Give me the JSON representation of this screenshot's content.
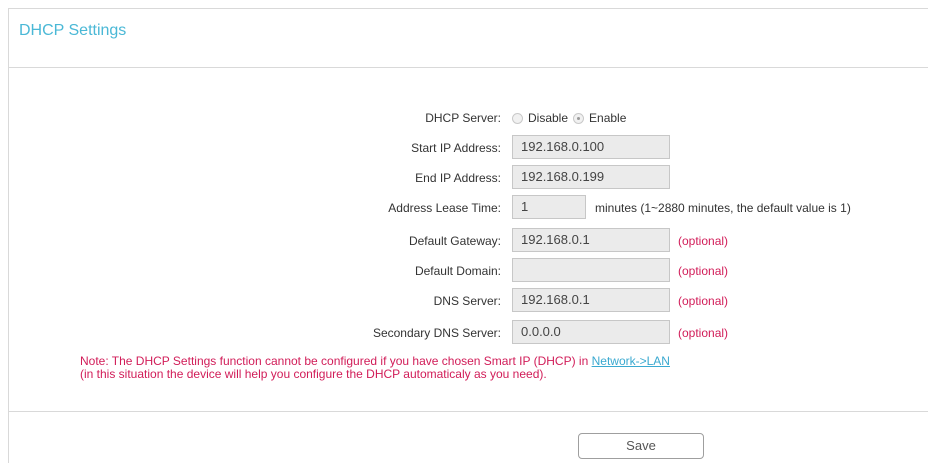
{
  "panel": {
    "title": "DHCP Settings"
  },
  "form": {
    "dhcp_server": {
      "label": "DHCP Server:",
      "options": [
        "Disable",
        "Enable"
      ],
      "selected": "Enable"
    },
    "start_ip": {
      "label": "Start IP Address:",
      "value": "192.168.0.100"
    },
    "end_ip": {
      "label": "End IP Address:",
      "value": "192.168.0.199"
    },
    "lease_time": {
      "label": "Address Lease Time:",
      "value": "1",
      "hint": "minutes (1~2880 minutes, the default value is 1)"
    },
    "default_gateway": {
      "label": "Default Gateway:",
      "value": "192.168.0.1",
      "note": "(optional)"
    },
    "default_domain": {
      "label": "Default Domain:",
      "value": "",
      "note": "(optional)"
    },
    "dns_server": {
      "label": "DNS Server:",
      "value": "192.168.0.1",
      "note": "(optional)"
    },
    "secondary_dns": {
      "label": "Secondary DNS Server:",
      "value": "0.0.0.0",
      "note": "(optional)"
    }
  },
  "note": {
    "line1": "Note: The DHCP Settings function cannot be configured if you have chosen Smart IP (DHCP) in ",
    "link": "Network->LAN",
    "line2": "(in this situation the device will help you configure the DHCP automaticaly as you need)."
  },
  "actions": {
    "save_label": "Save"
  },
  "colors": {
    "title": "#4ab8d6",
    "note": "#d11c58",
    "link": "#3aa9d0",
    "field_bg": "#ebebeb"
  }
}
